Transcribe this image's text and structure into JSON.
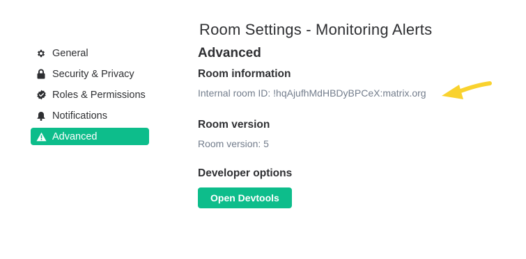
{
  "dialog": {
    "title": "Room Settings - Monitoring Alerts"
  },
  "sidebar": {
    "items": [
      {
        "label": "General",
        "icon": "gear-icon",
        "active": false
      },
      {
        "label": "Security & Privacy",
        "icon": "lock-icon",
        "active": false
      },
      {
        "label": "Roles & Permissions",
        "icon": "badge-check-icon",
        "active": false
      },
      {
        "label": "Notifications",
        "icon": "bell-icon",
        "active": false
      },
      {
        "label": "Advanced",
        "icon": "warning-icon",
        "active": true
      }
    ]
  },
  "main": {
    "section_title": "Advanced",
    "room_information": {
      "heading": "Room information",
      "room_id_line": "Internal room ID: !hqAjufhMdHBDyBPCeX:matrix.org"
    },
    "room_version": {
      "heading": "Room version",
      "version_line": "Room version: 5"
    },
    "developer": {
      "heading": "Developer options",
      "button_label": "Open Devtools"
    }
  },
  "annotation": {
    "icon": "arrow-icon",
    "color": "#f9d22e"
  },
  "colors": {
    "accent": "#0dbd8b",
    "muted_text": "#737d8c",
    "primary_text": "#2e2f32"
  }
}
